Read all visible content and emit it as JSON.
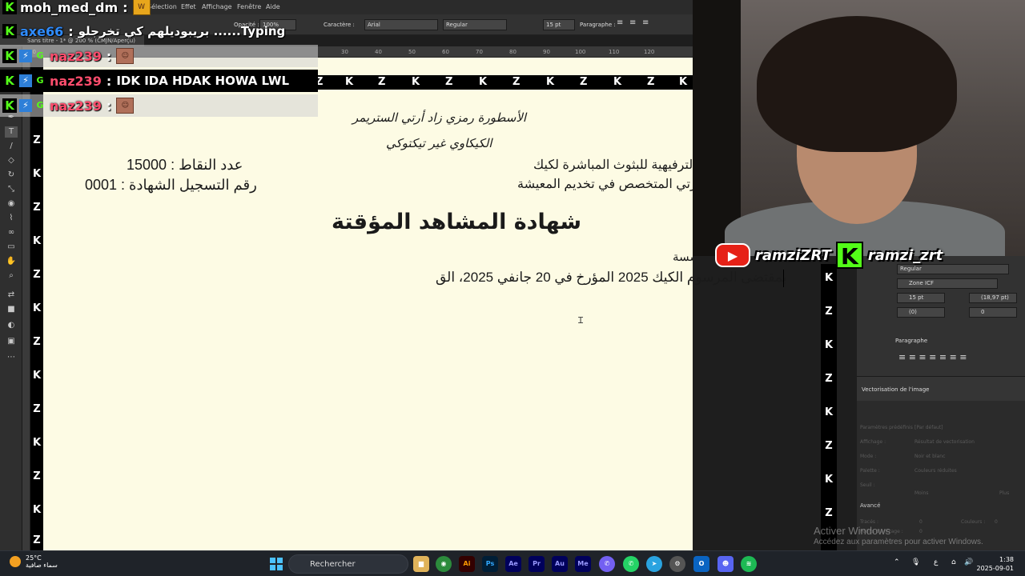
{
  "illustrator": {
    "menu": [
      "Sélection",
      "Effet",
      "Affichage",
      "Fenêtre",
      "Aide"
    ],
    "control": {
      "opacity_label": "Opacité :",
      "opacity_value": "100%",
      "caractere_label": "Caractère :",
      "font": "Arial",
      "style": "Regular",
      "size": "15 pt",
      "paragraphe_label": "Paragraphe :"
    },
    "doc_tab": "Sans titre - 1* @ 200 % (CMJN/Aperçu)",
    "ruler_ticks": [
      "20",
      "30",
      "40",
      "50",
      "60",
      "70",
      "80",
      "90",
      "100",
      "110",
      "120"
    ]
  },
  "certificate": {
    "slogan_line1": "الأسطورة رمزي زاد أرتي الستريمر",
    "slogan_line2": "الكيكاوي غير تيكتوكي",
    "header_right_line1": "الترفيهية للبثوث المباشرة لكيك",
    "header_right_line2": "رتي المتخصص في تخديم المعيشة",
    "points_label": "عدد النقاط : 15000",
    "registration_label": "رقم التسجيل الشهادة : 0001",
    "title": "شهادة المشاهد المؤقتة",
    "body_line1": "مؤسسة",
    "body_line2": "بمقتضى المرسوم الكيك 2025 المؤرخ في  20 جانفي 2025، الق",
    "strip_glyphs": [
      "K",
      "Z"
    ]
  },
  "chat": [
    {
      "user": "moh_med_dm",
      "color": "#ffffff",
      "message": "",
      "badges": [
        "kick"
      ]
    },
    {
      "user": "axe66",
      "color": "#2f8cff",
      "message": "بريبوديلهم كي تخرجلو ......Typing",
      "badges": [
        "kick"
      ]
    },
    {
      "user": "naz239",
      "color": "#ff4d6d",
      "message": "",
      "badges": [
        "kick",
        "b",
        "g"
      ],
      "emote": true
    },
    {
      "user": "naz239",
      "color": "#ff4d6d",
      "message": "IDK IDA HDAK HOWA LWL",
      "badges": [
        "kick",
        "b",
        "g"
      ]
    },
    {
      "user": "naz239",
      "color": "#ff4d6d",
      "message": "",
      "badges": [
        "kick",
        "b",
        "g"
      ],
      "emote": true
    }
  ],
  "socials": {
    "youtube": "ramziZRT",
    "kick": "ramzi_zrt"
  },
  "properties": {
    "style": "Regular",
    "zone": "Zone ICF",
    "size": "15 pt",
    "leading": "(18,97 pt)",
    "tracking_a": "(0)",
    "tracking_b": "0",
    "paragraphe": "Paragraphe"
  },
  "vectorisation": {
    "title": "Vectorisation de l'image",
    "rows": [
      {
        "label": "Paramètres prédéfinis :",
        "value": "[Par défaut]"
      },
      {
        "label": "Affichage :",
        "value": "Résultat de vectorisation"
      },
      {
        "label": "Mode :",
        "value": "Noir et blanc"
      },
      {
        "label": "Palette :",
        "value": "Couleurs réduites"
      },
      {
        "label": "Seuil :",
        "value": ""
      }
    ],
    "seuil_min": "Moins",
    "seuil_max": "Plus",
    "avance": "Avancé",
    "tracés": "Tracés :",
    "couleurs": "Couleurs :",
    "ancrage": "Points d'ancrage :",
    "tracés_val": "0",
    "couleurs_val": "0",
    "ancrage_val": "0"
  },
  "watermark": {
    "line1": "Activer Windows",
    "line2": "Accédez aux paramètres pour activer Windows."
  },
  "taskbar": {
    "weather_temp": "25°C",
    "weather_desc": "سماء صافية",
    "search": "Rechercher",
    "apps": [
      {
        "label": "Ai",
        "bg": "#330000",
        "fg": "#ff9a00"
      },
      {
        "label": "Ps",
        "bg": "#001e36",
        "fg": "#31a8ff"
      },
      {
        "label": "Ae",
        "bg": "#00005b",
        "fg": "#9999ff"
      },
      {
        "label": "Pr",
        "bg": "#00005b",
        "fg": "#9999ff"
      },
      {
        "label": "Au",
        "bg": "#00005b",
        "fg": "#9999ff"
      },
      {
        "label": "Me",
        "bg": "#00005b",
        "fg": "#9999ff"
      }
    ],
    "tray_lang": "ع",
    "time": "1:38",
    "date": "2025-09-01"
  }
}
